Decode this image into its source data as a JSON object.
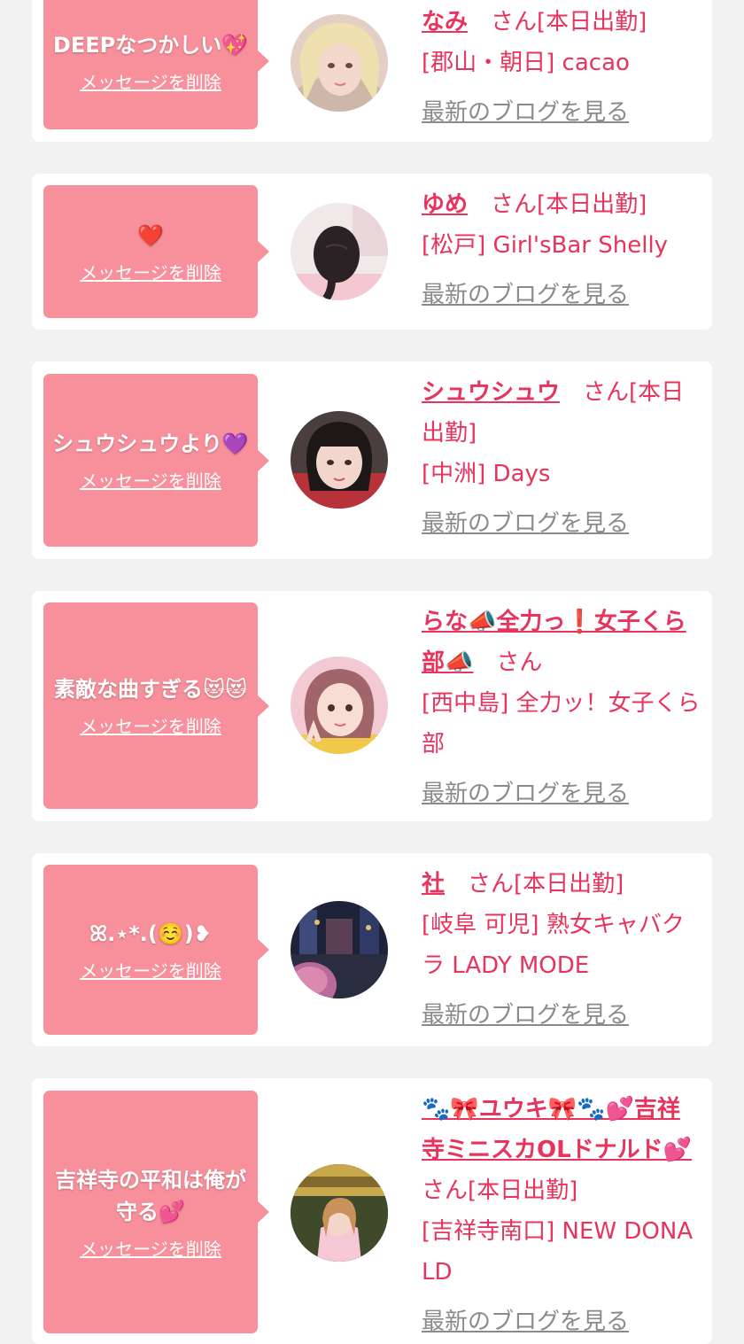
{
  "colors": {
    "accent": "#e8335c",
    "bubble": "#f7909a",
    "page_bg": "#f2f2f2"
  },
  "common": {
    "delete_label": "メッセージを削除",
    "blog_label": "最新のブログを見る"
  },
  "cards": [
    {
      "message": "DEEPなつかしい💖",
      "name": "なみ",
      "honorific": "　さん[本日出勤]",
      "shop": "[郡山・朝日] cacao"
    },
    {
      "message": "❤️",
      "name": "ゆめ",
      "honorific": "　さん[本日出勤]",
      "shop": "[松戸] Girl'sBar Shelly"
    },
    {
      "message": "シュウシュウより💜",
      "name": "シュウシュウ",
      "honorific": "　さん[本日出勤]",
      "shop": "[中洲] Days"
    },
    {
      "message": "素敵な曲すぎる😻😻",
      "name": "らな📣全力っ❗️女子くら部📣",
      "honorific": "　さん",
      "shop": "[西中島] 全力ッ！女子くら部"
    },
    {
      "message": "ꕤ.⋆*.(☺️)❥",
      "name": "社",
      "honorific": "　さん[本日出勤]",
      "shop": "[岐阜 可児] 熟女キャバクラ LADY MODE"
    },
    {
      "message": "吉祥寺の平和は俺が守る💕",
      "name": "🐾🎀ユウキ🎀🐾💕吉祥寺ミニスカOLドナルド💕",
      "honorific": "　さん[本日出勤]",
      "shop": "[吉祥寺南口] NEW DONALD"
    }
  ]
}
